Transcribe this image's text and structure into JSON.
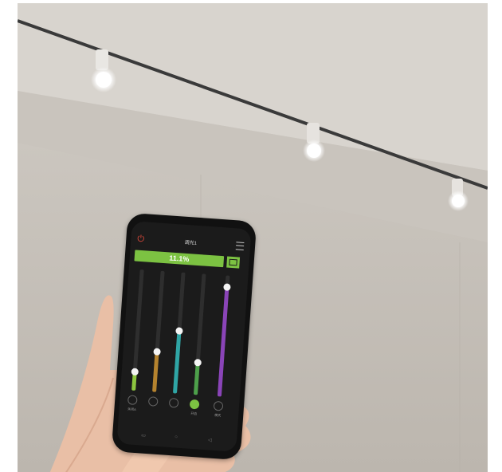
{
  "app": {
    "title": "调光1",
    "brightness_value": "11.1%",
    "icons": {
      "power": "power-icon",
      "menu": "menu-icon",
      "mode": "scene-mode-icon"
    },
    "sliders": [
      {
        "name": "channel-1",
        "level": 0.15,
        "color": "#8dc63f"
      },
      {
        "name": "channel-2",
        "level": 0.33,
        "color": "#b5832e"
      },
      {
        "name": "channel-3",
        "level": 0.51,
        "color": "#2fa5a5"
      },
      {
        "name": "channel-4",
        "level": 0.26,
        "color": "#4da04a"
      },
      {
        "name": "channel-5",
        "level": 0.9,
        "color": "#8a44b8"
      }
    ],
    "channel_buttons": [
      {
        "label": "关闭A",
        "active": false
      },
      {
        "label": "",
        "active": false
      },
      {
        "label": "",
        "active": false
      },
      {
        "label": "开启",
        "active": true
      },
      {
        "label": "模式",
        "active": false
      }
    ],
    "accent_color": "#7cc242"
  }
}
